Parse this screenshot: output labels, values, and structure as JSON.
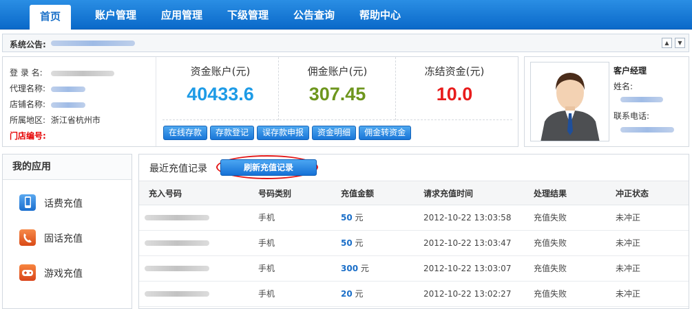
{
  "nav": {
    "items": [
      {
        "label": "首页"
      },
      {
        "label": "账户管理"
      },
      {
        "label": "应用管理"
      },
      {
        "label": "下级管理"
      },
      {
        "label": "公告查询"
      },
      {
        "label": "帮助中心"
      }
    ]
  },
  "notice": {
    "label": "系统公告:"
  },
  "account": {
    "fields": {
      "login": "登 录 名:",
      "agent": "代理名称:",
      "shop": "店铺名称:",
      "region_label": "所属地区:",
      "region_value": "浙江省杭州市",
      "store_no": "门店编号:"
    },
    "funds": [
      {
        "label": "资金账户(元)",
        "value": "40433.6",
        "color": "#1e9be6"
      },
      {
        "label": "佣金账户(元)",
        "value": "307.45",
        "color": "#6e961e"
      },
      {
        "label": "冻结资金(元)",
        "value": "10.0",
        "color": "#e81c1c"
      }
    ],
    "buttons": [
      "在线存款",
      "存款登记",
      "误存款申报",
      "资金明细",
      "佣金转资金"
    ]
  },
  "manager": {
    "title": "客户经理",
    "name_label": "姓名:",
    "phone_label": "联系电话:"
  },
  "apps": {
    "title": "我的应用",
    "items": [
      {
        "label": "话费充值",
        "icon": "phone-icon"
      },
      {
        "label": "固话充值",
        "icon": "landline-icon"
      },
      {
        "label": "游戏充值",
        "icon": "gamepad-icon"
      }
    ]
  },
  "records": {
    "title": "最近充值记录",
    "refresh_label": "刷新充值记录",
    "columns": [
      "充入号码",
      "号码类别",
      "充值金额",
      "请求充值时间",
      "处理结果",
      "冲正状态"
    ],
    "rows": [
      {
        "type": "手机",
        "amount": "50",
        "unit": "元",
        "time": "2012-10-22 13:03:58",
        "result": "充值失败",
        "reversal": "未冲正"
      },
      {
        "type": "手机",
        "amount": "50",
        "unit": "元",
        "time": "2012-10-22 13:03:47",
        "result": "充值失败",
        "reversal": "未冲正"
      },
      {
        "type": "手机",
        "amount": "300",
        "unit": "元",
        "time": "2012-10-22 13:03:07",
        "result": "充值失败",
        "reversal": "未冲正"
      },
      {
        "type": "手机",
        "amount": "20",
        "unit": "元",
        "time": "2012-10-22 13:02:27",
        "result": "充值失败",
        "reversal": "未冲正"
      }
    ]
  }
}
